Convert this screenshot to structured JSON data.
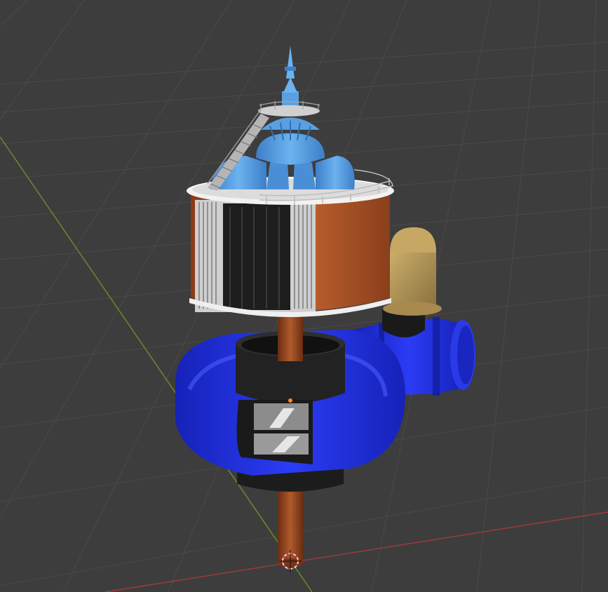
{
  "viewport": {
    "background": "#3d3d3d",
    "grid_color": "#4a4a4a",
    "axis_x_color": "#9c3a3e",
    "axis_y_color": "#6a8a2a"
  },
  "model": {
    "name": "",
    "parts": [
      "shaft",
      "spiral-casing",
      "wicket-gate-window",
      "generator-stator",
      "generator-top-deck",
      "rotor-spider",
      "exciter-spire",
      "staircase",
      "railing",
      "inlet-valve-housing"
    ],
    "colors": {
      "casing": "#1f2fe0",
      "shaft": "#8a3f1c",
      "stator": "#a65325",
      "rotor": "#5aa0e0",
      "deck": "#e8e8e8",
      "valve": "#b89a5a"
    }
  },
  "gizmo": {
    "origin_icon": "object-origin-icon",
    "cursor_icon": "3d-cursor-icon"
  }
}
